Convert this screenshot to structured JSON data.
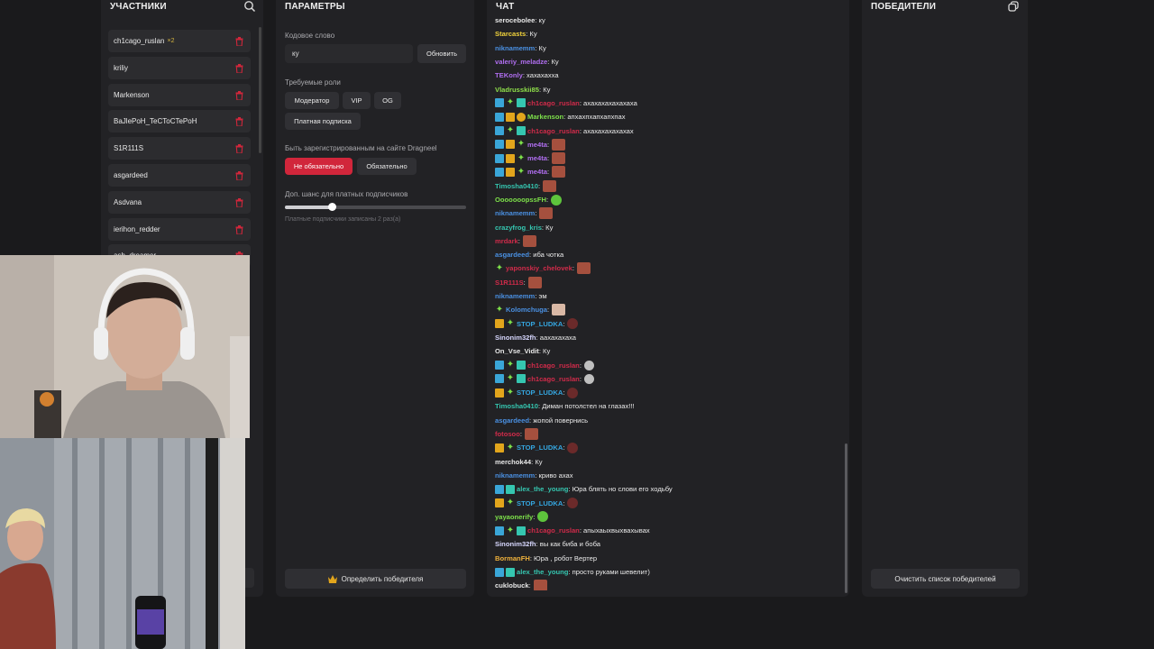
{
  "participants": {
    "title": "УЧАСТНИКИ",
    "items": [
      {
        "name": "ch1cago_ruslan",
        "badge": "×2"
      },
      {
        "name": "kriliy",
        "badge": ""
      },
      {
        "name": "Markenson",
        "badge": ""
      },
      {
        "name": "BaJlePoH_TeCToCTePoH",
        "badge": ""
      },
      {
        "name": "S1R111S",
        "badge": ""
      },
      {
        "name": "asgardeed",
        "badge": ""
      },
      {
        "name": "Asdvana",
        "badge": ""
      },
      {
        "name": "ierihon_redder",
        "badge": ""
      },
      {
        "name": "ash_dreamer",
        "badge": ""
      }
    ]
  },
  "params": {
    "title": "ПАРАМЕТРЫ",
    "code_label": "Кодовое слово",
    "code_value": "ку",
    "refresh_label": "Обновить",
    "roles_label": "Требуемые роли",
    "roles": [
      "Модератор",
      "VIP",
      "OG",
      "Платная подписка"
    ],
    "registered_label": "Быть зарегистрированным на сайте Dragneel",
    "not_required_label": "Не обязательно",
    "required_label": "Обязательно",
    "chance_label": "Доп. шанс для платных подписчиков",
    "chance_fraction": 0.26,
    "chance_note": "Платные подписчики записаны 2 раз(а)",
    "winner_button": "Определить победителя"
  },
  "chat": {
    "title": "ЧАТ",
    "messages": [
      {
        "user": "serocebolee",
        "color": "#e8e8e8",
        "icons": [],
        "text": ": ку",
        "emote": ""
      },
      {
        "user": "Starcasts",
        "color": "#f0d23c",
        "icons": [],
        "text": ": Ку",
        "emote": ""
      },
      {
        "user": "niknamemm",
        "color": "#4a90e2",
        "icons": [],
        "text": ": Ку",
        "emote": ""
      },
      {
        "user": "valeriy_meladze",
        "color": "#b06ef0",
        "icons": [],
        "text": ": Ку",
        "emote": ""
      },
      {
        "user": "TEKonly",
        "color": "#b06ef0",
        "icons": [],
        "text": ": хахахахха",
        "emote": ""
      },
      {
        "user": "Vladrusskii85",
        "color": "#8fe04a",
        "icons": [],
        "text": ": Ку",
        "emote": ""
      },
      {
        "user": "ch1cago_ruslan",
        "color": "#d12b4a",
        "icons": [
          "up",
          "star",
          "gift"
        ],
        "text": ": ахахахахахахаха",
        "emote": ""
      },
      {
        "user": "Markenson",
        "color": "#7de04a",
        "icons": [
          "up",
          "crown",
          "coin"
        ],
        "text": ": апхахпхапхапхпах",
        "emote": ""
      },
      {
        "user": "ch1cago_ruslan",
        "color": "#d12b4a",
        "icons": [
          "up",
          "star",
          "gift"
        ],
        "text": ": ахахахахахахах",
        "emote": ""
      },
      {
        "user": "me4ta",
        "color": "#b06ef0",
        "icons": [
          "up",
          "crown",
          "star"
        ],
        "text": ":",
        "emote": "face"
      },
      {
        "user": "me4ta",
        "color": "#b06ef0",
        "icons": [
          "up",
          "crown",
          "star"
        ],
        "text": ":",
        "emote": "face"
      },
      {
        "user": "me4ta",
        "color": "#b06ef0",
        "icons": [
          "up",
          "crown",
          "star"
        ],
        "text": ":",
        "emote": "face"
      },
      {
        "user": "Timosha0410",
        "color": "#35c6b0",
        "icons": [],
        "text": ":",
        "emote": "face"
      },
      {
        "user": "OoooooopssFH",
        "color": "#7de04a",
        "icons": [],
        "text": ":",
        "emote": "green"
      },
      {
        "user": "niknamemm",
        "color": "#4a90e2",
        "icons": [],
        "text": ":",
        "emote": "face"
      },
      {
        "user": "crazyfrog_kris",
        "color": "#35c6b0",
        "icons": [],
        "text": ": Ку",
        "emote": ""
      },
      {
        "user": "mrdark",
        "color": "#d12b4a",
        "icons": [],
        "text": ":",
        "emote": "face"
      },
      {
        "user": "asgardeed",
        "color": "#4a90e2",
        "icons": [],
        "text": ": иба чотка",
        "emote": ""
      },
      {
        "user": "yaponskiy_chelovek",
        "color": "#d12b4a",
        "icons": [
          "star"
        ],
        "text": ":",
        "emote": "face"
      },
      {
        "user": "S1R111S",
        "color": "#d12b4a",
        "icons": [],
        "text": ":",
        "emote": "face"
      },
      {
        "user": "niknamemm",
        "color": "#4a90e2",
        "icons": [],
        "text": ": эм",
        "emote": ""
      },
      {
        "user": "Kolomchuga",
        "color": "#4a90e2",
        "icons": [
          "star"
        ],
        "text": ":",
        "emote": "pale"
      },
      {
        "user": "STOP_LUDKA",
        "color": "#35a6e0",
        "icons": [
          "crown",
          "star"
        ],
        "text": ":",
        "emote": "dark"
      },
      {
        "user": "Sinonim32fh",
        "color": "#d8d8ff",
        "icons": [],
        "text": ": аахахахаха",
        "emote": ""
      },
      {
        "user": "On_Vse_Vidit",
        "color": "#e8e8e8",
        "icons": [],
        "text": ": Ку",
        "emote": ""
      },
      {
        "user": "ch1cago_ruslan",
        "color": "#d12b4a",
        "icons": [
          "up",
          "star",
          "gift"
        ],
        "text": ":",
        "emote": "gray"
      },
      {
        "user": "ch1cago_ruslan",
        "color": "#d12b4a",
        "icons": [
          "up",
          "star",
          "gift"
        ],
        "text": ":",
        "emote": "gray"
      },
      {
        "user": "STOP_LUDKA",
        "color": "#35a6e0",
        "icons": [
          "crown",
          "star"
        ],
        "text": ":",
        "emote": "dark"
      },
      {
        "user": "Timosha0410",
        "color": "#35c6b0",
        "icons": [],
        "text": ": Диман потолстел на глазах!!!",
        "emote": ""
      },
      {
        "user": "asgardeed",
        "color": "#4a90e2",
        "icons": [],
        "text": ": жопой повернись",
        "emote": ""
      },
      {
        "user": "fotosoo",
        "color": "#d12b4a",
        "icons": [],
        "text": ":",
        "emote": "face"
      },
      {
        "user": "STOP_LUDKA",
        "color": "#35a6e0",
        "icons": [
          "crown",
          "star"
        ],
        "text": ":",
        "emote": "dark"
      },
      {
        "user": "merchok44",
        "color": "#e8e8e8",
        "icons": [],
        "text": ": Ку",
        "emote": ""
      },
      {
        "user": "niknamemm",
        "color": "#4a90e2",
        "icons": [],
        "text": ": криво ахах",
        "emote": ""
      },
      {
        "user": "alex_the_young",
        "color": "#35c6b0",
        "icons": [
          "up",
          "gift"
        ],
        "text": ": Юра блять но слови его ходьбу",
        "emote": ""
      },
      {
        "user": "STOP_LUDKA",
        "color": "#35a6e0",
        "icons": [
          "crown",
          "star"
        ],
        "text": ":",
        "emote": "dark"
      },
      {
        "user": "yayaonerify",
        "color": "#7de04a",
        "icons": [],
        "text": ":",
        "emote": "green"
      },
      {
        "user": "ch1cago_ruslan",
        "color": "#d12b4a",
        "icons": [
          "up",
          "star",
          "gift"
        ],
        "text": ": апыхаыхвыхвахывах",
        "emote": ""
      },
      {
        "user": "Sinonim32fh",
        "color": "#d8d8ff",
        "icons": [],
        "text": ": вы как биба и боба",
        "emote": ""
      },
      {
        "user": "BormanFH",
        "color": "#f0b23c",
        "icons": [],
        "text": ": Юра , робот Вертер",
        "emote": ""
      },
      {
        "user": "alex_the_young",
        "color": "#35c6b0",
        "icons": [
          "up",
          "gift"
        ],
        "text": ": просто руками шевелит)",
        "emote": ""
      },
      {
        "user": "cuklobuck",
        "color": "#e8e8e8",
        "icons": [],
        "text": ":",
        "emote": "face"
      }
    ]
  },
  "winners": {
    "title": "ПОБЕДИТЕЛИ",
    "clear_button": "Очистить список победителей"
  }
}
